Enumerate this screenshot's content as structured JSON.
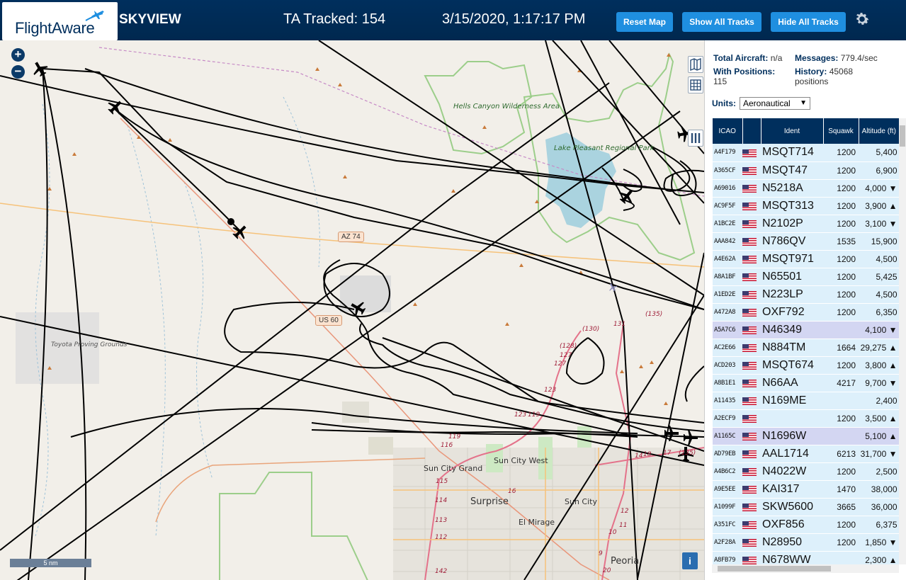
{
  "header": {
    "logo_text": "FlightAware",
    "app_title": "SKYVIEW",
    "tracked": "TA Tracked: 154",
    "clock": "3/15/2020, 1:17:17 PM",
    "reset_label": "Reset Map",
    "show_label": "Show All Tracks",
    "hide_label": "Hide All Tracks",
    "settings_icon": "gear-icon"
  },
  "map": {
    "zoom_in": "+",
    "zoom_out": "−",
    "scale_label": "5 nm",
    "info_label": "i",
    "labels": {
      "hells_canyon": "Hells Canyon Wilderness Area",
      "lake_pleasant": "Lake Pleasant Regional Park",
      "toyota": "Toyota Proving Grounds",
      "sun_city_grand": "Sun City Grand",
      "sun_city_west": "Sun City West",
      "surprise": "Surprise",
      "sun_city": "Sun City",
      "el_mirage": "El Mirage",
      "peoria": "Peoria",
      "az74": "AZ 74",
      "us60": "US 60"
    },
    "road_numbers": [
      "(135)",
      "131",
      "(130)",
      "(128)",
      "127",
      "127",
      "123",
      "123",
      "119",
      "119",
      "116",
      "115",
      "114",
      "113",
      "112",
      "142",
      "16",
      "18",
      "17",
      "14",
      "12",
      "11",
      "10",
      "9",
      "20",
      "(135)"
    ]
  },
  "panel": {
    "total_aircraft_label": "Total Aircraft:",
    "total_aircraft_value": "n/a",
    "messages_label": "Messages:",
    "messages_value": "779.4/sec",
    "with_positions_label": "With Positions:",
    "with_positions_value": "115",
    "history_label": "History:",
    "history_value": "45068",
    "history_unit": "positions",
    "units_label": "Units:",
    "units_value": "Aeronautical"
  },
  "table": {
    "headers": [
      "ICAO",
      "",
      "Ident",
      "Squawk",
      "Altitude (ft)"
    ],
    "rows": [
      {
        "icao": "A4F179",
        "ident": "MSQT714",
        "squawk": "1200",
        "alt": "5,400",
        "trend": ""
      },
      {
        "icao": "A365CF",
        "ident": "MSQT47",
        "squawk": "1200",
        "alt": "6,900",
        "trend": ""
      },
      {
        "icao": "A69016",
        "ident": "N5218A",
        "squawk": "1200",
        "alt": "4,000",
        "trend": "▼"
      },
      {
        "icao": "AC9F5F",
        "ident": "MSQT313",
        "squawk": "1200",
        "alt": "3,900",
        "trend": "▲"
      },
      {
        "icao": "A1BC2E",
        "ident": "N2102P",
        "squawk": "1200",
        "alt": "3,100",
        "trend": "▼"
      },
      {
        "icao": "AAA842",
        "ident": "N786QV",
        "squawk": "1535",
        "alt": "15,900",
        "trend": ""
      },
      {
        "icao": "A4E62A",
        "ident": "MSQT971",
        "squawk": "1200",
        "alt": "4,500",
        "trend": ""
      },
      {
        "icao": "A8A1BF",
        "ident": "N65501",
        "squawk": "1200",
        "alt": "5,425",
        "trend": ""
      },
      {
        "icao": "A1ED2E",
        "ident": "N223LP",
        "squawk": "1200",
        "alt": "4,500",
        "trend": ""
      },
      {
        "icao": "A472A8",
        "ident": "OXF792",
        "squawk": "1200",
        "alt": "6,350",
        "trend": ""
      },
      {
        "icao": "A5A7C6",
        "ident": "N46349",
        "squawk": "",
        "alt": "4,100",
        "trend": "▼",
        "sel": true
      },
      {
        "icao": "AC2E66",
        "ident": "N884TM",
        "squawk": "1664",
        "alt": "29,275",
        "trend": "▲"
      },
      {
        "icao": "ACD203",
        "ident": "MSQT674",
        "squawk": "1200",
        "alt": "3,800",
        "trend": "▲"
      },
      {
        "icao": "A8B1E1",
        "ident": "N66AA",
        "squawk": "4217",
        "alt": "9,700",
        "trend": "▼"
      },
      {
        "icao": "A11435",
        "ident": "N169ME",
        "squawk": "",
        "alt": "2,400",
        "trend": ""
      },
      {
        "icao": "A2ECF9",
        "ident": "",
        "squawk": "1200",
        "alt": "3,500",
        "trend": "▲"
      },
      {
        "icao": "A1165C",
        "ident": "N1696W",
        "squawk": "",
        "alt": "5,100",
        "trend": "▲",
        "sel": true
      },
      {
        "icao": "AD79EB",
        "ident": "AAL1714",
        "squawk": "6213",
        "alt": "31,700",
        "trend": "▼"
      },
      {
        "icao": "A4B6C2",
        "ident": "N4022W",
        "squawk": "1200",
        "alt": "2,500",
        "trend": ""
      },
      {
        "icao": "A9E5EE",
        "ident": "KAI317",
        "squawk": "1470",
        "alt": "38,000",
        "trend": ""
      },
      {
        "icao": "A1099F",
        "ident": "SKW5600",
        "squawk": "3665",
        "alt": "36,000",
        "trend": ""
      },
      {
        "icao": "A351FC",
        "ident": "OXF856",
        "squawk": "1200",
        "alt": "6,375",
        "trend": ""
      },
      {
        "icao": "A2F28A",
        "ident": "N28950",
        "squawk": "1200",
        "alt": "1,850",
        "trend": "▼"
      },
      {
        "icao": "A8FB79",
        "ident": "N678WW",
        "squawk": "",
        "alt": "2,300",
        "trend": "▲"
      }
    ]
  },
  "colors": {
    "header_bg": "#002f5d",
    "button_bg": "#1f8fe0",
    "row_bg": "#ddf0fb",
    "row_selected_bg": "#d3d6f2",
    "track_color": "#000000",
    "map_bg": "#f2efe9"
  }
}
